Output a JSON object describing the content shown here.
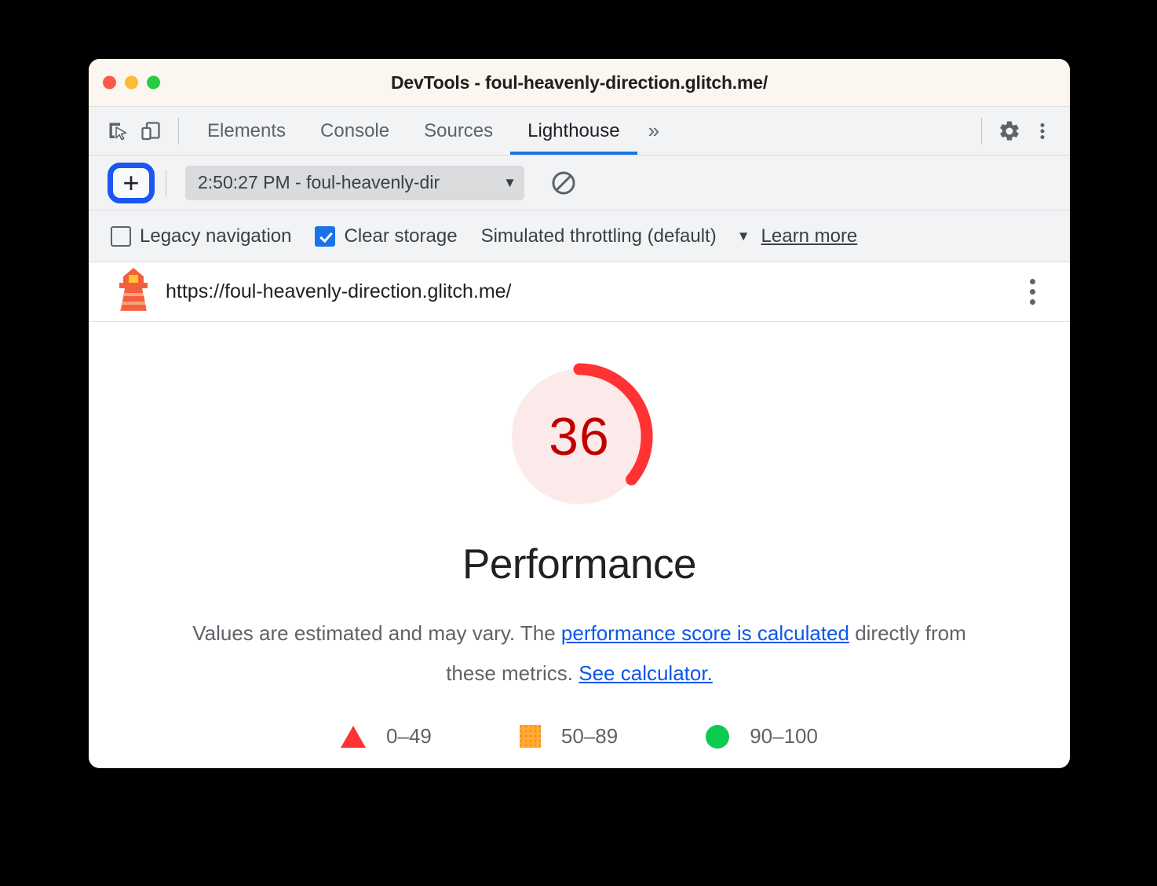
{
  "window": {
    "title": "DevTools - foul-heavenly-direction.glitch.me/",
    "traffic_lights": [
      "close",
      "minimize",
      "maximize"
    ]
  },
  "tabbar": {
    "inspect_icon": "inspect-cursor-icon",
    "device_icon": "device-toolbar-icon",
    "tabs": [
      {
        "label": "Elements",
        "active": false
      },
      {
        "label": "Console",
        "active": false
      },
      {
        "label": "Sources",
        "active": false
      },
      {
        "label": "Lighthouse",
        "active": true
      }
    ],
    "more_tabs": "»",
    "settings_icon": "gear-icon",
    "overflow_icon": "kebab-menu-icon"
  },
  "lighthouse_toolbar": {
    "add_button": "+",
    "report_select_value": "2:50:27 PM - foul-heavenly-dir",
    "report_select_arrow": "▼",
    "clear_icon": "clear-all-icon",
    "highlight_color": "#1a56f0"
  },
  "lighthouse_settings": {
    "legacy_navigation": {
      "label": "Legacy navigation",
      "checked": false
    },
    "clear_storage": {
      "label": "Clear storage",
      "checked": true
    },
    "throttling": {
      "label": "Simulated throttling (default)",
      "arrow": "▼"
    },
    "learn_more": "Learn more"
  },
  "report": {
    "logo": "lighthouse-icon",
    "url": "https://foul-heavenly-direction.glitch.me/",
    "menu_icon": "kebab-menu-icon"
  },
  "score": {
    "value": "36",
    "value_number": 36,
    "category": "Performance",
    "arc_color": "#f33",
    "arc_bg_color": "#fce9e9",
    "text_color": "#c00000"
  },
  "disclaimer": {
    "lead": "Values are estimated and may vary. The ",
    "link1": "performance score is calculated",
    "middle": " directly from these metrics. ",
    "link2": "See calculator."
  },
  "legend": [
    {
      "shape": "triangle",
      "color": "#ff3333",
      "label": "0–49"
    },
    {
      "shape": "square",
      "color": "#ffaa33",
      "label": "50–89"
    },
    {
      "shape": "circle",
      "color": "#0ccb51",
      "label": "90–100"
    }
  ]
}
